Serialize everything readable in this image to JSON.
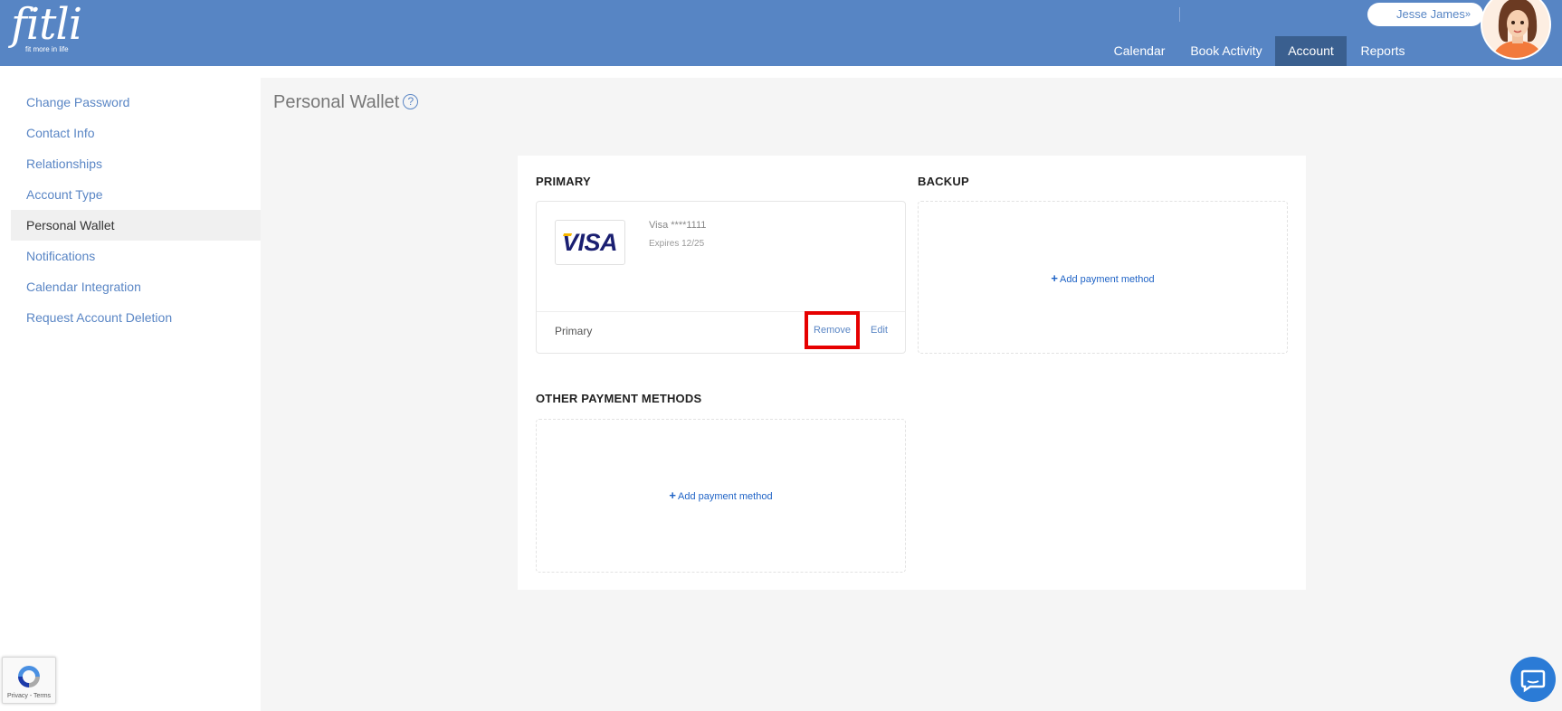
{
  "header": {
    "logo": "fitli",
    "tagline": "fit more in life",
    "user_name": "Jesse James",
    "nav": [
      {
        "label": "Calendar"
      },
      {
        "label": "Book Activity"
      },
      {
        "label": "Account"
      },
      {
        "label": "Reports"
      }
    ]
  },
  "sidebar": {
    "items": [
      {
        "label": "Change Password"
      },
      {
        "label": "Contact Info"
      },
      {
        "label": "Relationships"
      },
      {
        "label": "Account Type"
      },
      {
        "label": "Personal Wallet"
      },
      {
        "label": "Notifications"
      },
      {
        "label": "Calendar Integration"
      },
      {
        "label": "Request Account Deletion"
      }
    ]
  },
  "page": {
    "title": "Personal Wallet",
    "help_icon": "?"
  },
  "wallet": {
    "primary_title": "PRIMARY",
    "backup_title": "BACKUP",
    "other_title": "OTHER PAYMENT METHODS",
    "primary_card": {
      "brand": "VISA",
      "number": "Visa ****1111",
      "expires": "Expires 12/25",
      "status": "Primary",
      "remove_label": "Remove",
      "edit_label": "Edit"
    },
    "add_payment_label": "Add payment method"
  },
  "recaptcha": {
    "text": "Privacy - Terms"
  },
  "colors": {
    "header": "#5785c4",
    "nav_active": "#3a5f8f",
    "link": "#5a86c5",
    "highlight": "#e60000"
  }
}
